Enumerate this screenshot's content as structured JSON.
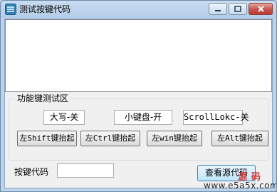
{
  "window": {
    "title": "测试按键代码",
    "controls": {
      "minimize_icon": "minimize-icon",
      "maximize_icon": "maximize-icon",
      "close_icon": "close-icon"
    }
  },
  "output_box": {
    "value": ""
  },
  "function_keys_group": {
    "title": "功能键测试区",
    "status": {
      "caps_lock": "大写-关",
      "num_lock": "小键盘-开",
      "scroll_lock": "ScrollLokc-关"
    },
    "buttons": {
      "shift": "左Shift键抬起",
      "ctrl": "左Ctrl键抬起",
      "win": "左win键抬起",
      "alt": "左Alt键抬起"
    }
  },
  "key_code": {
    "label": "按键代码",
    "value": ""
  },
  "view_source_button": {
    "label": "查看源代码"
  },
  "watermark": {
    "brand": "源码",
    "url": "www.e5a5x.com"
  },
  "colors": {
    "title_bar": "#bcd3ec",
    "close_button": "#c75050",
    "watermark": "#d23b3b"
  }
}
